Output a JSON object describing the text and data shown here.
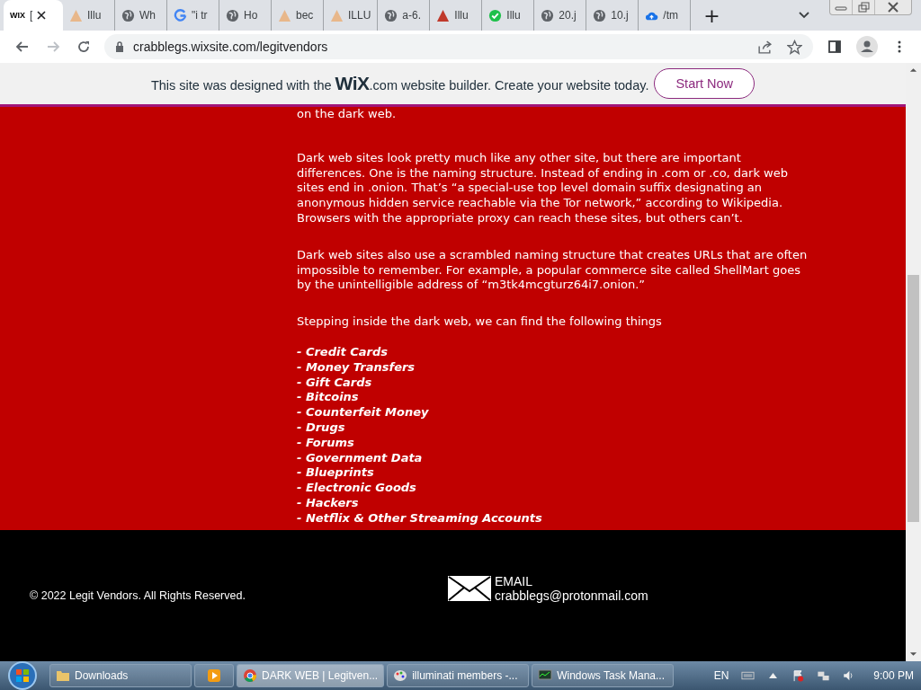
{
  "browser": {
    "tabs": [
      {
        "title": "[",
        "selected": true
      },
      {
        "title": "Illu",
        "selected": false
      },
      {
        "title": "Wh",
        "selected": false
      },
      {
        "title": "\"i tr",
        "selected": false
      },
      {
        "title": "Ho",
        "selected": false
      },
      {
        "title": "bec",
        "selected": false
      },
      {
        "title": "ILLU",
        "selected": false
      },
      {
        "title": "a-6.",
        "selected": false
      },
      {
        "title": "Illu",
        "selected": false
      },
      {
        "title": "Illu",
        "selected": false
      },
      {
        "title": "20.j",
        "selected": false
      },
      {
        "title": "10.j",
        "selected": false
      },
      {
        "title": "/tm",
        "selected": false
      }
    ],
    "new_tab": "+",
    "favicon_wix": "WIX",
    "address": "crabblegs.wixsite.com/legitvendors"
  },
  "wix_banner": {
    "text": "This site was designed with the **WiX**.com website builder. Create your website today.",
    "button": "Start Now"
  },
  "content": {
    "paragraphs": [
      "on the dark web.",
      "Dark web sites look pretty much like any other site, but there are important differences. One is the naming structure. Instead of ending in .com or .co, dark web sites end in .onion. That’s “a special-use top level domain suffix designating an anonymous hidden service reachable via the Tor network,” according to Wikipedia. Browsers with the appropriate proxy can reach these sites, but others can’t.",
      "Dark web sites also use a scrambled naming structure that creates URLs that are often impossible to remember. For example, a popular commerce site called ShellMart goes by the unintelligible address of “m3tk4mcgturz64i7.onion.”",
      "Stepping inside the dark web, we can find the following things"
    ],
    "list": [
      "- Credit Cards",
      "- Money Transfers",
      "- Gift Cards",
      "- Bitcoins",
      "- Counterfeit Money",
      "- Drugs",
      "- Forums",
      "- Government Data",
      "- Blueprints",
      "- Electronic Goods",
      "- Hackers",
      "- Netflix & Other Streaming Accounts"
    ]
  },
  "footer": {
    "copyright": "© 2022 Legit Vendors. All Rights Reserved.",
    "email_label": "EMAIL",
    "email": "crabblegs@protonmail.com"
  },
  "taskbar": {
    "items": [
      {
        "label": "Downloads",
        "selected": false
      },
      {
        "selected": false
      },
      {
        "label": "DARK WEB | Legitven...",
        "selected": true
      },
      {
        "label": "illuminati members -...",
        "selected": false
      },
      {
        "label": "Windows Task Mana...",
        "selected": false
      }
    ],
    "language": "EN",
    "clock": "9:00 PM"
  }
}
